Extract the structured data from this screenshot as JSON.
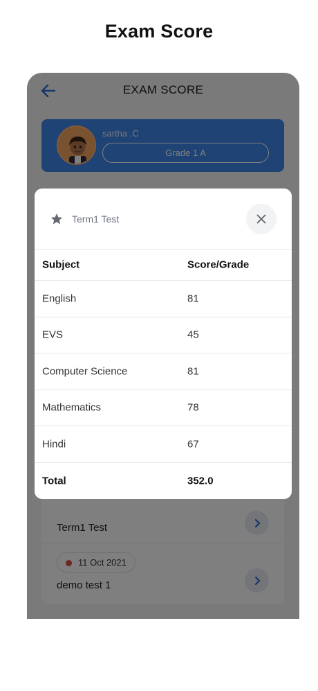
{
  "page_heading": "Exam Score",
  "app_bar": {
    "title": "EXAM SCORE",
    "back_icon": "arrow-left-icon"
  },
  "profile": {
    "name": "sartha .C",
    "grade": "Grade 1 A"
  },
  "exam_list": [
    {
      "date": "",
      "name": "Term1 Test"
    },
    {
      "date": "11 Oct 2021",
      "name": "demo test 1"
    }
  ],
  "modal": {
    "title": "Term1 Test",
    "columns": [
      "Subject",
      "Score/Grade"
    ],
    "rows": [
      {
        "subject": "English",
        "score": "81"
      },
      {
        "subject": "EVS",
        "score": "45"
      },
      {
        "subject": "Computer Science",
        "score": "81"
      },
      {
        "subject": "Mathematics",
        "score": "78"
      },
      {
        "subject": "Hindi",
        "score": "67"
      }
    ],
    "total_label": "Total",
    "total_value": "352.0"
  },
  "colors": {
    "accent": "#3f86e8",
    "back_arrow": "#2d6fd6",
    "status_dot": "#e14b4b"
  }
}
